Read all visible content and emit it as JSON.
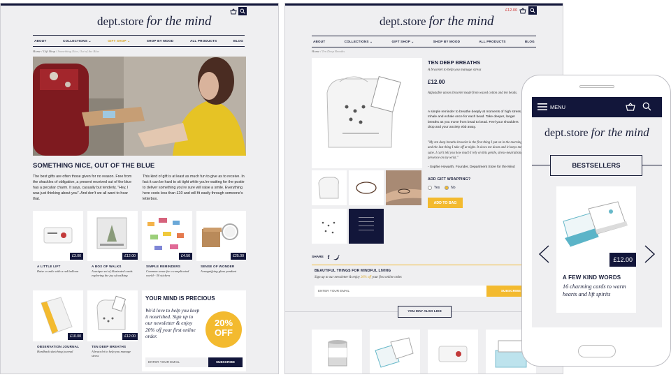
{
  "logo": {
    "a": "dept.store",
    "b": "for the mind"
  },
  "nav": [
    "ABOUT",
    "COLLECTIONS ⌄",
    "GIFT SHOP ⌄",
    "SHOP BY MOOD",
    "ALL PRODUCTS",
    "BLOG"
  ],
  "p1": {
    "breadcrumb": {
      "home": "Home",
      "sep1": " / ",
      "shop": "Gift Shop",
      "sep2": " / ",
      "current": "Something Nice, Out of the Blue"
    },
    "heading": "SOMETHING NICE, OUT OF THE BLUE",
    "col1": "The best gifts are often those given for no reason. Free from the shackles of obligation, a present received out of the blue has a peculiar charm. It says, casually but tenderly, \"Hey, I was just thinking about you\". And don't we all want to hear that.",
    "col2": "This kind of gift is at least as much fun to give as to receive. In fact it can be hard to sit tight while you're waiting for the postie to deliver something you're sure will raise a smile. Everything here costs less than £10 and will fit easily through someone's letterbox.",
    "products": [
      {
        "title": "A LITTLE LIFT",
        "sub": "Raise a smile with a red balloon",
        "price": "£3.00"
      },
      {
        "title": "A BOX OF WALKS",
        "sub": "A unique set of illustrated cards exploring the joy of walking",
        "price": "£12.00"
      },
      {
        "title": "SIMPLE REMINDERS",
        "sub": "Common sense for a complicated world - 30 stickers",
        "price": "£4.50"
      },
      {
        "title": "SENSE OF WONDER",
        "sub": "A magnifying glass pendant",
        "price": "£25.00"
      },
      {
        "title": "OBSERVATION JOURNAL",
        "sub": "Hardback sketching journal",
        "price": "£10.00"
      },
      {
        "title": "TEN DEEP BREATHS",
        "sub": "A bracelet to help you manage stress",
        "price": "£12.00"
      }
    ],
    "promo": {
      "title": "YOUR MIND IS PRECIOUS",
      "text": "We'd love to help you keep it nourished. Sign up to our newsletter & enjoy 20% off your first online order.",
      "badge1": "20%",
      "badge2": "OFF",
      "placeholder": "ENTER YOUR EMAIL",
      "button": "SUBSCRIBE"
    }
  },
  "p2": {
    "cart_price": "£12.00",
    "breadcrumb": {
      "home": "Home",
      "sep": " / ",
      "current": "Ten Deep Breaths"
    },
    "product": {
      "title": "TEN DEEP BREATHS",
      "subtitle": "A bracelet to help you manage stress",
      "price": "£12.00",
      "desc1": "Adjustable unisex bracelet made from waxed cotton and ten beads.",
      "desc2": "A simple reminder to breathe deeply at moments of high stress. Inhale and exhale once for each bead. Take deeper, longer breaths as you move from bead to bead. Feel your shoulders drop and your anxiety ebb away.",
      "quote": "\"My ten deep breaths bracelet is the first thing I put on in the morning, and the last thing I take off at night. It slows me down and it keeps me sane. I can't tell you how much I rely on this gentle, stress-neutralising presence on my wrist.\"",
      "quote_author": "- Sophie Howarth, Founder, Department Store for the Mind",
      "gift_q": "ADD GIFT WRAPPING?",
      "yes": "Yes",
      "no": "No",
      "add": "ADD TO BAG"
    },
    "share": "SHARE",
    "newsletter": {
      "title": "BEAUTIFUL THINGS FOR MINDFUL LIVING",
      "text_a": "Sign up to our newsletter & enjoy ",
      "text_b": "20% off",
      "text_c": " your first online order.",
      "placeholder": "ENTER YOUR EMAIL",
      "button": "SUBSCRIBE"
    },
    "also": "YOU MAY ALSO LIKE"
  },
  "phone": {
    "menu": "MENU",
    "section": "BESTSELLERS",
    "price": "£12.00",
    "title": "A FEW KIND WORDS",
    "sub": "16 charming cards to warm hearts and lift spirits"
  }
}
